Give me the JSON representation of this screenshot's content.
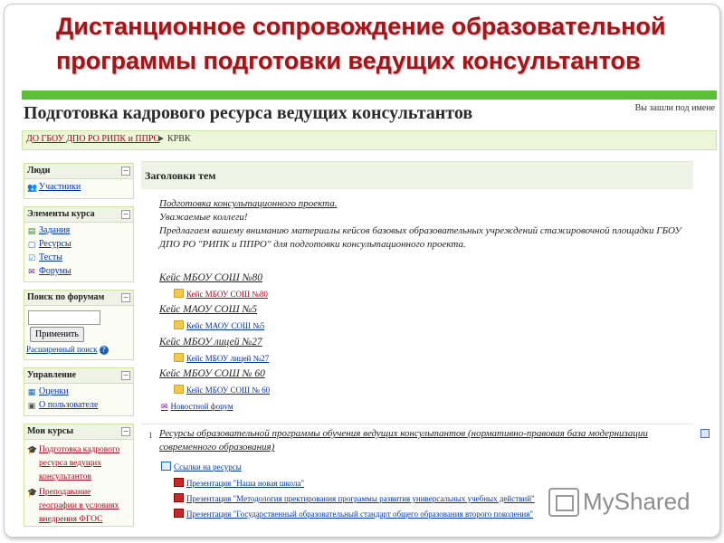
{
  "slide_title": "Дистанционное сопровождение образовательной программы подготовки ведущих консультантов",
  "site": {
    "title": "Подготовка кадрового ресурса ведущих консультантов",
    "login_info": "Вы зашли под имене",
    "breadcrumb_root": "ДО ГБОУ ДПО РО РИПК и ППРО",
    "breadcrumb_sep": "►",
    "breadcrumb_current": "КРВК"
  },
  "sidebar": {
    "people": {
      "title": "Люди",
      "items": [
        "Участники"
      ]
    },
    "course_elements": {
      "title": "Элементы курса",
      "items": [
        "Задания",
        "Ресурсы",
        "Тесты",
        "Форумы"
      ]
    },
    "forum_search": {
      "title": "Поиск по форумам",
      "button": "Применить",
      "advanced": "Расширенный поиск"
    },
    "management": {
      "title": "Управление",
      "items": [
        "Оценки",
        "О пользователе"
      ]
    },
    "my_courses": {
      "title": "Мои курсы",
      "items": [
        "Подготовка кадрового ресурса ведущих консультантов",
        "Преподавание географии в условиях внедрения ФГОС"
      ]
    }
  },
  "main": {
    "header": "Заголовки тем",
    "intro": {
      "link": "Подготовка консультационного проекта.",
      "greeting": "Уважаемые коллеги!",
      "text": "Предлагаем вашему вниманию материалы кейсов базовых образовательных учреждений стажировочной площадки ГБОУ ДПО РО \"РИПК и ППРО\" для подготовки консультационного проекта."
    },
    "cases": [
      {
        "title": "Кейс МБОУ СОШ №80",
        "file": "Кейс МБОУ СОШ №80"
      },
      {
        "title": "Кейс МАОУ СОШ №5",
        "file": "Кейс МАОУ СОШ №5"
      },
      {
        "title": "Кейс МБОУ лицей №27",
        "file": "Кейс МБОУ лицей №27"
      },
      {
        "title": "Кейс МБОУ СОШ № 60",
        "file": "Кейс МБОУ СОШ № 60"
      }
    ],
    "news_forum": "Новостной форум",
    "section1": {
      "number": "1",
      "title": "Ресурсы образовательной программы обучения ведущих консультантов (нормативно-правовая база модернизации современного образования)",
      "links": "Ссылки на ресурсы",
      "presentations": [
        "Презентация \"Наша новая школа\"",
        "Презентация \"Методология пректирования программы развития универсальных учебных действий\"",
        "Презентация \"Государственный образовательный стандарт общего образования второго поколения\""
      ]
    }
  },
  "watermark": "MyShared",
  "colors": {
    "title": "#a0161b",
    "accent_green": "#5bbf3a",
    "link": "#0033aa",
    "breadcrumb": "#b0001c"
  }
}
